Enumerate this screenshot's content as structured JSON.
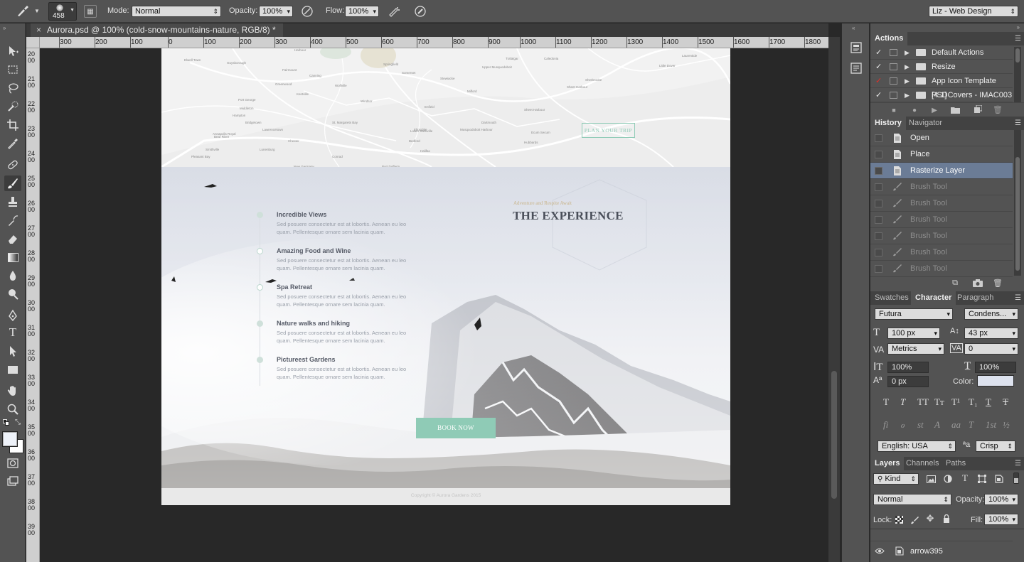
{
  "options_bar": {
    "brush_size": "458",
    "mode_label": "Mode:",
    "mode_value": "Normal",
    "opacity_label": "Opacity:",
    "opacity_value": "100%",
    "flow_label": "Flow:",
    "flow_value": "100%",
    "workspace": "Liz - Web Design"
  },
  "document_tab": {
    "title": "Aurora.psd @ 100% (cold-snow-mountains-nature, RGB/8) *",
    "close": "×"
  },
  "horizontal_ruler": [
    "300",
    "200",
    "100",
    "0",
    "100",
    "200",
    "300",
    "400",
    "500",
    "600",
    "700",
    "800",
    "900",
    "1000",
    "1100",
    "1200",
    "1300",
    "1400",
    "1500",
    "1600",
    "1700",
    "1800"
  ],
  "vertical_ruler": [
    "2000",
    "2100",
    "2200",
    "2300",
    "2400",
    "2500",
    "2600",
    "2700",
    "2800",
    "2900",
    "3000",
    "3100",
    "3200",
    "3300",
    "3400",
    "3500",
    "3600",
    "3700",
    "3800",
    "3900"
  ],
  "canvas": {
    "map_button": "PLAN YOUR TRIP",
    "map_places": [
      "Harbour",
      "Elwell Town",
      "Guysborough",
      "Trafalgar",
      "Caledonia",
      "Laurentide",
      "Upper Musquodoboit",
      "Little Dover",
      "Fairmount",
      "Canning",
      "Wolfville",
      "Stewiacke",
      "Somerset",
      "Greenwood",
      "Kentville",
      "Windsor",
      "Milford",
      "Sheet Harbour",
      "Port George",
      "Middleton",
      "Enfield",
      "Elmsdale",
      "Halifax",
      "Bedford",
      "Lower Sackville",
      "Dartmouth",
      "Musquodoboit Harbour",
      "Bridgetown",
      "Hampton",
      "Bear River",
      "Annapolis Royal",
      "Lawrencetown",
      "Chester",
      "Lunenburg",
      "New Germany",
      "Port Dufferin",
      "Ecum Secum",
      "Sherbrooke",
      "St. Margarets Bay",
      "Smithville",
      "Pleasant Bay",
      "Springfield",
      "Hubbards",
      "Conrad",
      "Sheet Harbour"
    ],
    "subtitle": "Adventure and Respite Await",
    "heading": "THE EXPERIENCE",
    "features": [
      {
        "title": "Incredible Views",
        "body": "Sed posuere consectetur est at lobortis.  Aenean eu leo quam. Pellentesque ornare sem lacinia quam."
      },
      {
        "title": "Amazing Food and Wine",
        "body": "Sed posuere consectetur est at lobortis.  Aenean eu leo quam. Pellentesque ornare sem lacinia quam."
      },
      {
        "title": "Spa Retreat",
        "body": "Sed posuere consectetur est at lobortis.  Aenean eu leo quam. Pellentesque ornare sem lacinia quam."
      },
      {
        "title": "Nature walks and hiking",
        "body": "Sed posuere consectetur est at lobortis.  Aenean eu leo quam. Pellentesque ornare sem lacinia quam."
      },
      {
        "title": "Pictureest Gardens",
        "body": "Sed posuere consectetur est at lobortis.  Aenean eu leo quam. Pellentesque ornare sem lacinia quam."
      }
    ],
    "cta": "BOOK NOW",
    "footer": "Copyright © Aurora Gardens 2015"
  },
  "actions_panel": {
    "tab": "Actions",
    "items": [
      {
        "label": "Default Actions",
        "red_check": false
      },
      {
        "label": "Resize",
        "red_check": false
      },
      {
        "label": "App Icon Template [4.1]",
        "red_check": true
      },
      {
        "label": "PSDCovers - IMAC003",
        "red_check": false
      }
    ]
  },
  "history_panel": {
    "tabs": [
      "History",
      "Navigator"
    ],
    "items": [
      {
        "label": "Open",
        "state": "normal"
      },
      {
        "label": "Place",
        "state": "normal"
      },
      {
        "label": "Rasterize Layer",
        "state": "selected"
      },
      {
        "label": "Brush Tool",
        "state": "dim"
      },
      {
        "label": "Brush Tool",
        "state": "dim"
      },
      {
        "label": "Brush Tool",
        "state": "dim"
      },
      {
        "label": "Brush Tool",
        "state": "dim"
      },
      {
        "label": "Brush Tool",
        "state": "dim"
      },
      {
        "label": "Brush Tool",
        "state": "dim"
      }
    ]
  },
  "character_panel": {
    "tabs": [
      "Swatches",
      "Character",
      "Paragraph"
    ],
    "font_family": "Futura",
    "font_style": "Condens...",
    "font_size": "100 px",
    "leading": "43 px",
    "kerning": "Metrics",
    "tracking": "0",
    "vertical_scale": "100%",
    "horizontal_scale": "100%",
    "baseline_shift": "0 px",
    "color_label": "Color:",
    "color_value": "#dde2ee",
    "glyphs_row1": [
      "T",
      "T",
      "TT",
      "Tт",
      "T¹",
      "T₁",
      "T",
      "T"
    ],
    "glyphs_row2": [
      "fi",
      "ℴ",
      "st",
      "A",
      "aa",
      "T",
      "1st",
      "½"
    ],
    "language": "English: USA",
    "aa_label": "ªa",
    "antialias": "Crisp"
  },
  "layers_panel": {
    "tabs": [
      "Layers",
      "Channels",
      "Paths"
    ],
    "kind": "Kind",
    "blend_mode": "Normal",
    "opacity_label": "Opacity:",
    "opacity_value": "100%",
    "lock_label": "Lock:",
    "fill_label": "Fill:",
    "fill_value": "100%",
    "layer_name": "arrow395"
  },
  "colors": {
    "accent_teal": "#8fcbb6",
    "selection": "#6b7c96",
    "panel_bg": "#535353"
  }
}
